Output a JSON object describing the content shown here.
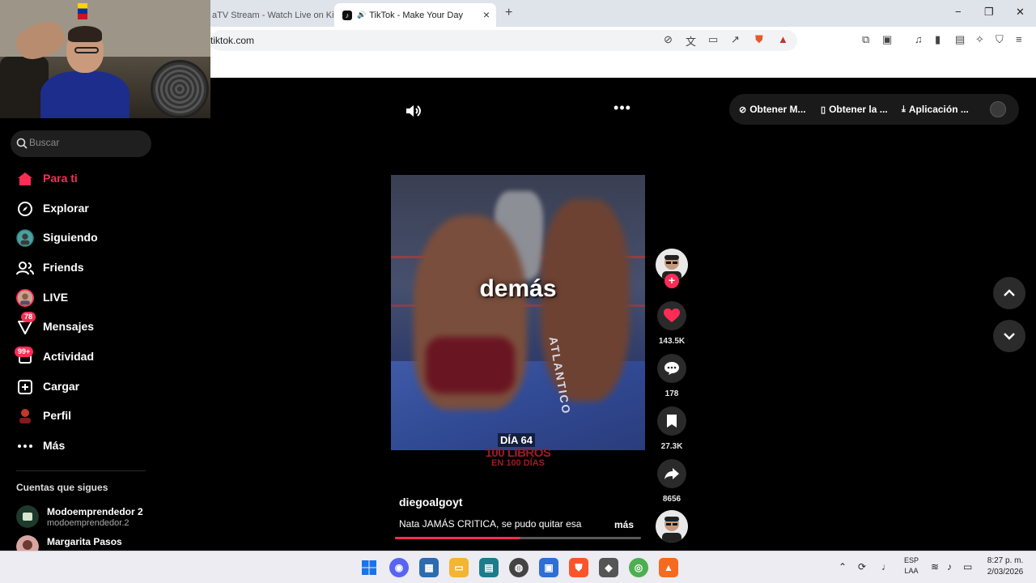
{
  "browser": {
    "tabs": [
      {
        "label": "aTV Stream - Watch Live on Kick",
        "active": false
      },
      {
        "label": "TikTok - Make Your Day",
        "active": true
      }
    ],
    "url": "tiktok.com",
    "new_tab": "+",
    "close_tab": "×",
    "window_controls": {
      "minimize": "−",
      "restore": "❐",
      "close": "✕"
    }
  },
  "sidebar": {
    "search_placeholder": "Buscar",
    "nav": [
      {
        "label": "Para ti",
        "icon": "home-icon",
        "active": true
      },
      {
        "label": "Explorar",
        "icon": "compass-icon"
      },
      {
        "label": "Siguiendo",
        "icon": "following-avatar-icon"
      },
      {
        "label": "Friends",
        "icon": "friends-icon"
      },
      {
        "label": "LIVE",
        "icon": "live-avatar-icon"
      },
      {
        "label": "Mensajes",
        "icon": "messages-icon",
        "badge": "78"
      },
      {
        "label": "Actividad",
        "icon": "activity-icon",
        "badge": "99+"
      },
      {
        "label": "Cargar",
        "icon": "upload-icon"
      },
      {
        "label": "Perfil",
        "icon": "profile-icon"
      },
      {
        "label": "Más",
        "icon": "more-icon"
      }
    ],
    "following_title": "Cuentas que sigues",
    "following": [
      {
        "name": "Modoemprendedor 2",
        "handle": "modoemprendedor.2"
      },
      {
        "name": "Margarita Pasos",
        "handle": ""
      }
    ]
  },
  "video": {
    "caption_overlay": "demás",
    "day_label": "DÍA 64",
    "series_title_1": "100 LIBROS",
    "series_title_2": "EN 100 DÍAS",
    "author": "diegoalgoyt",
    "description": "Nata JAMÁS CRITICA, se pudo quitar esa",
    "more": "más",
    "apron_text": "ATLANTICO",
    "progress": 0.51
  },
  "actions": {
    "likes": "143.5K",
    "comments": "178",
    "saves": "27.3K",
    "shares": "8656"
  },
  "top_pill": {
    "item1": "Obtener M...",
    "item2": "Obtener la ...",
    "item3": "Aplicación ..."
  },
  "taskbar": {
    "lang_1": "ESP",
    "lang_2": "LAA",
    "time": "8:27 p. m.",
    "date": "2/03/2026"
  },
  "colors": {
    "accent": "#fe2c55",
    "background": "#000000",
    "sidebar_search_bg": "#1f1f1f"
  }
}
